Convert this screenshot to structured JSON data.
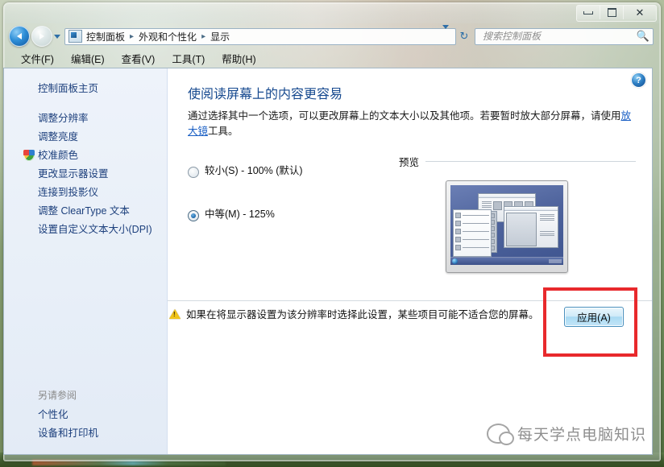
{
  "window": {
    "controls": {
      "minimize": "minimize-icon",
      "maximize": "maximize-icon",
      "close": "close-icon"
    }
  },
  "navbar": {
    "back_tooltip": "后退",
    "forward_tooltip": "前进",
    "breadcrumb": [
      "控制面板",
      "外观和个性化",
      "显示"
    ],
    "separator": "▸",
    "refresh_icon": "refresh-icon",
    "dropdown_icon": "chevron-down-icon"
  },
  "search": {
    "placeholder": "搜索控制面板",
    "value": "",
    "icon": "search-icon"
  },
  "menubar": {
    "items": [
      "文件(F)",
      "编辑(E)",
      "查看(V)",
      "工具(T)",
      "帮助(H)"
    ]
  },
  "sidebar": {
    "home": "控制面板主页",
    "items": [
      {
        "label": "调整分辨率",
        "icon": null
      },
      {
        "label": "调整亮度",
        "icon": null
      },
      {
        "label": "校准颜色",
        "icon": "shield-icon"
      },
      {
        "label": "更改显示器设置",
        "icon": null
      },
      {
        "label": "连接到投影仪",
        "icon": null
      },
      {
        "label": "调整 ClearType 文本",
        "icon": null
      },
      {
        "label": "设置自定义文本大小(DPI)",
        "icon": null
      }
    ],
    "see_also_label": "另请参阅",
    "see_also_items": [
      "个性化",
      "设备和打印机"
    ]
  },
  "main": {
    "help_icon": "help-icon",
    "title": "使阅读屏幕上的内容更容易",
    "description_part1": "通过选择其中一个选项，可以更改屏幕上的文本大小以及其他项。若要暂时放大部分屏幕，请使用",
    "description_link": "放大镜",
    "description_part2": "工具。",
    "scale_options": [
      {
        "label": "较小(S) - 100% (默认)",
        "selected": false
      },
      {
        "label": "中等(M) - 125%",
        "selected": true
      }
    ],
    "preview_label": "预览",
    "warning_icon": "warning-icon",
    "warning_text": "如果在将显示器设置为该分辨率时选择此设置，某些项目可能不适合您的屏幕。",
    "apply_label": "应用(A)",
    "apply_highlight_color": "#e8292c"
  },
  "watermark": {
    "icon": "wechat-icon",
    "text": "每天学点电脑知识"
  }
}
